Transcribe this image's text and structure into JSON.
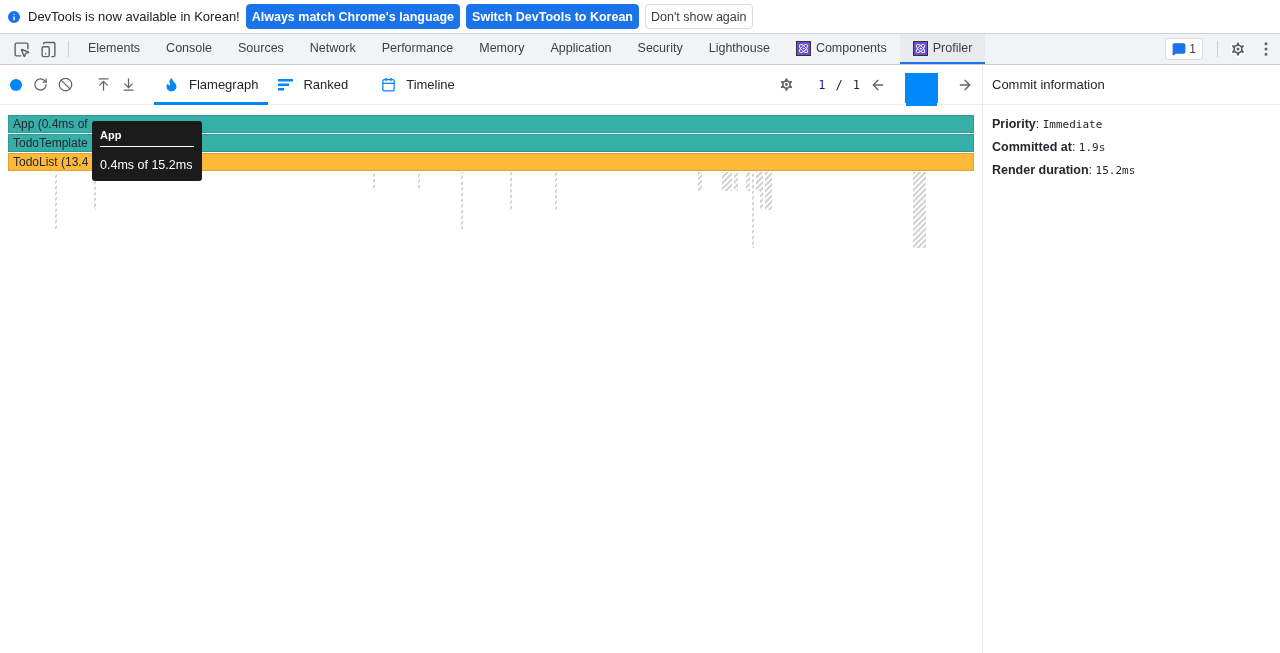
{
  "infobar": {
    "message": "DevTools is now available in Korean!",
    "buttons": [
      {
        "label": "Always match Chrome's language",
        "kind": "primary"
      },
      {
        "label": "Switch DevTools to Korean",
        "kind": "primary"
      },
      {
        "label": "Don't show again",
        "kind": "secondary"
      }
    ]
  },
  "tabs": [
    {
      "label": "Elements",
      "selected": false,
      "kind": "plain"
    },
    {
      "label": "Console",
      "selected": false,
      "kind": "plain"
    },
    {
      "label": "Sources",
      "selected": false,
      "kind": "plain"
    },
    {
      "label": "Network",
      "selected": false,
      "kind": "plain"
    },
    {
      "label": "Performance",
      "selected": false,
      "kind": "plain"
    },
    {
      "label": "Memory",
      "selected": false,
      "kind": "plain"
    },
    {
      "label": "Application",
      "selected": false,
      "kind": "plain"
    },
    {
      "label": "Security",
      "selected": false,
      "kind": "plain"
    },
    {
      "label": "Lighthouse",
      "selected": false,
      "kind": "plain"
    },
    {
      "label": "Components",
      "selected": false,
      "kind": "react"
    },
    {
      "label": "Profiler",
      "selected": true,
      "kind": "react"
    }
  ],
  "issues_count": "1",
  "view_tabs": [
    {
      "label": "Flamegraph",
      "selected": true,
      "kind": "flame"
    },
    {
      "label": "Ranked",
      "selected": false,
      "kind": "ranked"
    },
    {
      "label": "Timeline",
      "selected": false,
      "kind": "timeline"
    }
  ],
  "commit_nav": {
    "current": "1",
    "separator": "/",
    "total": "1",
    "commits": [
      {
        "level": 1,
        "selected": true
      }
    ]
  },
  "flamegraph": {
    "bars": [
      {
        "label": "App (0.4ms of",
        "color": "#37afa9"
      },
      {
        "label": "TodoTemplate",
        "color": "#37afa9"
      },
      {
        "label": "TodoList (13.4",
        "color": "#ffb938"
      }
    ]
  },
  "tooltip": {
    "title": "App",
    "text": "0.4ms of 15.2ms"
  },
  "commit_info": {
    "title": "Commit information",
    "fields": [
      {
        "label": "Priority",
        "separator": ":",
        "value": "Immediate"
      },
      {
        "label": "Committed at",
        "separator": ":",
        "value": "1.9s"
      },
      {
        "label": "Render duration",
        "separator": ":",
        "value": "15.2ms"
      }
    ]
  }
}
